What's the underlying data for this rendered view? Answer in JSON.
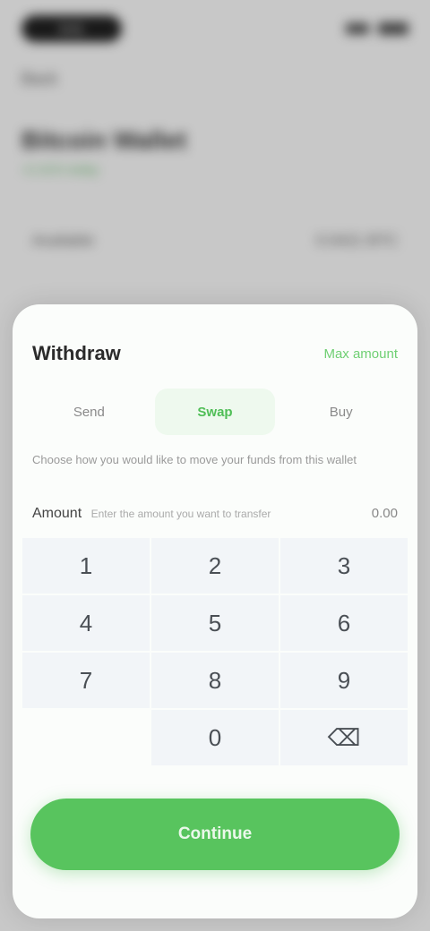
{
  "status_bar": {
    "time": "9:41",
    "signal_icon": "signal-icon",
    "battery_icon": "battery-icon"
  },
  "background": {
    "back_label": "Back",
    "asset_title": "Bitcoin Wallet",
    "asset_sub": "+2.41% today",
    "row_left": "Available",
    "row_right": "0.0421 BTC"
  },
  "sheet": {
    "title": "Withdraw",
    "action": "Max amount",
    "segments": [
      "Send",
      "Swap",
      "Buy"
    ],
    "active_segment": 1,
    "hint": "Choose how you would like to move your funds from this wallet",
    "amount_label": "Amount",
    "amount_hint": "Enter the amount you want to transfer",
    "amount_value": "0.00",
    "keys": [
      "1",
      "2",
      "3",
      "4",
      "5",
      "6",
      "7",
      "8",
      "9",
      "",
      "0",
      "⌫"
    ],
    "confirm_label": "Continue"
  },
  "colors": {
    "accent": "#58c45e",
    "sheet_bg": "#fbfdfb",
    "screen_bg": "#d9d9d9"
  }
}
